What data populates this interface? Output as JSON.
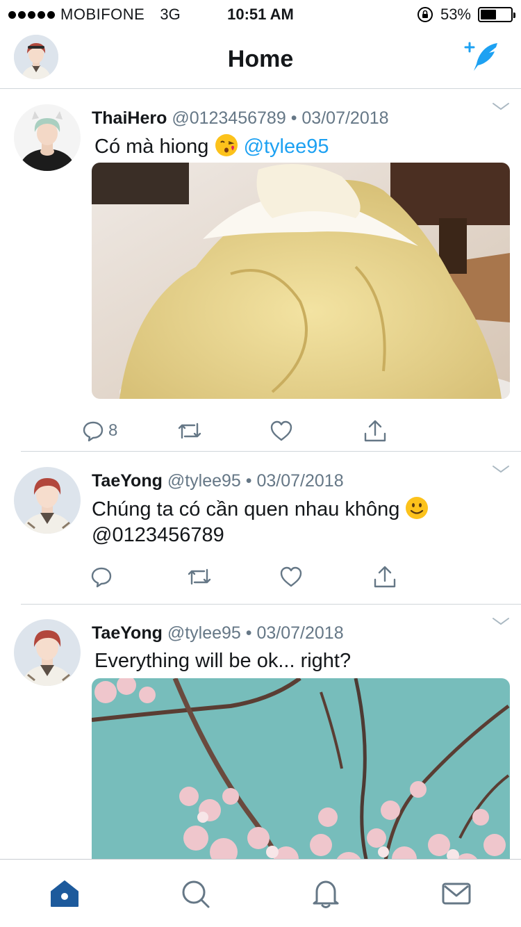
{
  "status_bar": {
    "carrier": "MOBIFONE",
    "network": "3G",
    "time": "10:51 AM",
    "battery": "53%",
    "battery_level": 0.53
  },
  "header": {
    "title": "Home",
    "avatar": "profile-avatar-icon",
    "compose": "compose-tweet-icon"
  },
  "colors": {
    "accent": "#1da1f2",
    "text_primary": "#14171a",
    "text_secondary": "#657786",
    "tab_active": "#1d5a9c"
  },
  "tweets": [
    {
      "name": "ThaiHero",
      "handle": "@0123456789",
      "separator": "•",
      "date": "03/07/2018",
      "text": "Có mà hiong",
      "emoji": "kissing-face-emoji",
      "mention": "@tylee95",
      "media": "durian-dessert-photo",
      "reply_count": "8"
    },
    {
      "name": "TaeYong",
      "handle": "@tylee95",
      "separator": "•",
      "date": "03/07/2018",
      "text": "Chúng ta có cần quen nhau không",
      "emoji": "smiling-face-emoji",
      "text_line2": "@0123456789"
    },
    {
      "name": "TaeYong",
      "handle": "@tylee95",
      "separator": "•",
      "date": "03/07/2018",
      "text": "Everything will be ok... right?",
      "media": "cherry-blossom-photo"
    }
  ],
  "tabbar": {
    "items": [
      "home-icon",
      "search-icon",
      "notifications-icon",
      "messages-icon"
    ],
    "active": "home-icon"
  }
}
